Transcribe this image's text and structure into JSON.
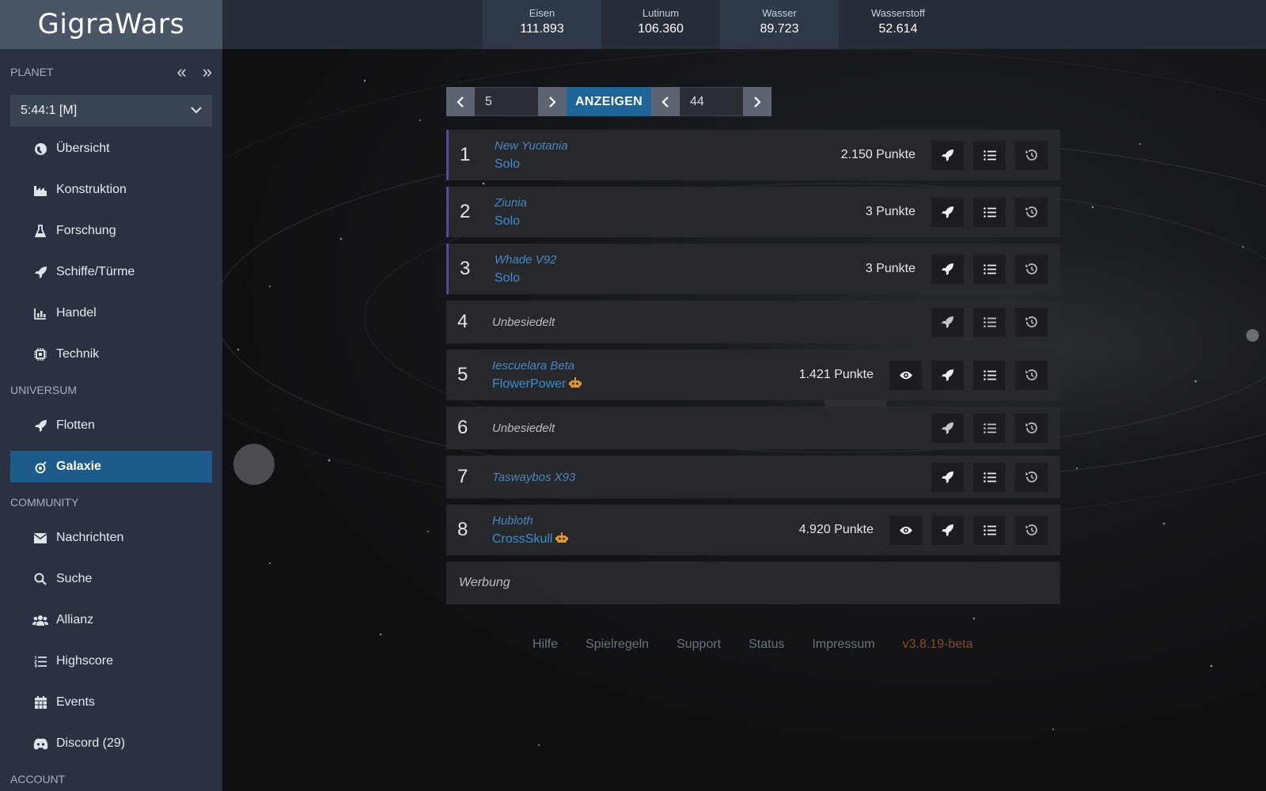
{
  "app": {
    "title": "GigraWars"
  },
  "resources": [
    {
      "name": "Eisen",
      "value": "111.893"
    },
    {
      "name": "Lutinum",
      "value": "106.360"
    },
    {
      "name": "Wasser",
      "value": "89.723"
    },
    {
      "name": "Wasserstoff",
      "value": "52.614"
    }
  ],
  "sidebar": {
    "planet_section": "PLANET",
    "planet_selected": "5:44:1 [M]",
    "planet_items": [
      {
        "label": "Übersicht",
        "icon": "globe-icon"
      },
      {
        "label": "Konstruktion",
        "icon": "industry-icon"
      },
      {
        "label": "Forschung",
        "icon": "flask-icon"
      },
      {
        "label": "Schiffe/Türme",
        "icon": "rocket-icon"
      },
      {
        "label": "Handel",
        "icon": "chart-icon"
      },
      {
        "label": "Technik",
        "icon": "chip-icon"
      }
    ],
    "universe_section": "UNIVERSUM",
    "universe_items": [
      {
        "label": "Flotten",
        "icon": "rocket-icon"
      },
      {
        "label": "Galaxie",
        "icon": "satellite-icon",
        "active": true
      }
    ],
    "community_section": "COMMUNITY",
    "community_items": [
      {
        "label": "Nachrichten",
        "icon": "envelope-icon"
      },
      {
        "label": "Suche",
        "icon": "search-icon"
      },
      {
        "label": "Allianz",
        "icon": "users-icon"
      },
      {
        "label": "Highscore",
        "icon": "list-ol-icon"
      },
      {
        "label": "Events",
        "icon": "calendar-icon"
      },
      {
        "label": "Discord (29)",
        "icon": "discord-icon"
      }
    ],
    "account_section": "ACCOUNT"
  },
  "galaxy_nav": {
    "galaxy": "5",
    "system": "44",
    "show_label": "ANZEIGEN"
  },
  "rows": [
    {
      "pos": "1",
      "planet": "New Yuotania",
      "owner": "Solo",
      "points": "2.150 Punkte",
      "spy": false,
      "bot": false
    },
    {
      "pos": "2",
      "planet": "Ziunia",
      "owner": "Solo",
      "points": "3 Punkte",
      "spy": false,
      "bot": false
    },
    {
      "pos": "3",
      "planet": "Whade V92",
      "owner": "Solo",
      "points": "3 Punkte",
      "spy": false,
      "bot": false
    },
    {
      "pos": "4",
      "planet": "Unbesiedelt",
      "owner": "",
      "points": "",
      "spy": false,
      "bot": false
    },
    {
      "pos": "5",
      "planet": "Iescuelara Beta",
      "owner": "FlowerPower",
      "points": "1.421 Punkte",
      "spy": true,
      "bot": true
    },
    {
      "pos": "6",
      "planet": "Unbesiedelt",
      "owner": "",
      "points": "",
      "spy": false,
      "bot": false
    },
    {
      "pos": "7",
      "planet": "Taswaybos X93",
      "owner": "",
      "points": "",
      "spy": false,
      "bot": false
    },
    {
      "pos": "8",
      "planet": "Hubloth",
      "owner": "CrossSkull",
      "points": "4.920 Punkte",
      "spy": true,
      "bot": true
    }
  ],
  "ad_label": "Werbung",
  "footer": {
    "links": [
      "Hilfe",
      "Spielregeln",
      "Support",
      "Status",
      "Impressum"
    ],
    "version": "v3.8.19-beta"
  },
  "colors": {
    "sidebar_bg": "#2a3241",
    "active_nav": "#1d5b8a",
    "link_blue": "#3b8ed3",
    "occupied_border": "#5847a0",
    "version_text": "#8a4a22"
  }
}
